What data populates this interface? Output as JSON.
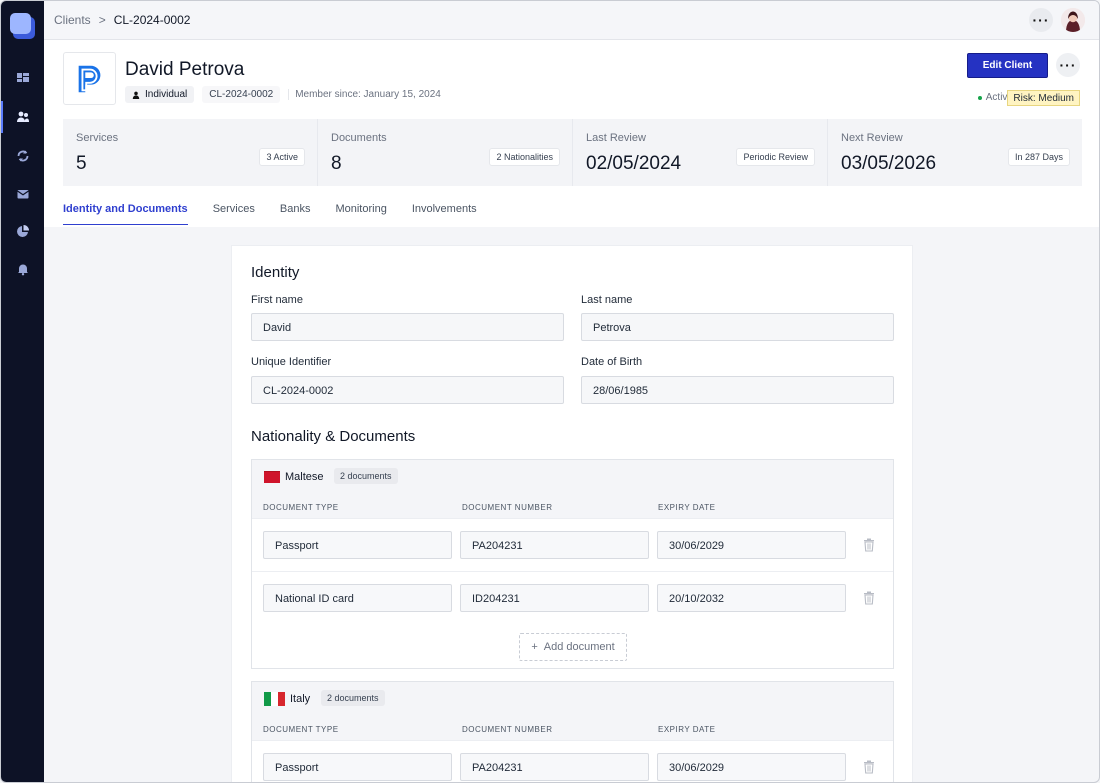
{
  "breadcrumb": {
    "parent": "Clients",
    "separator": ">",
    "current": "CL-2024-0002"
  },
  "client": {
    "name": "David Petrova",
    "type": "Individual",
    "id": "CL-2024-0002",
    "member_since": "Member since: January 15,  2024",
    "status": "Active",
    "risk": "Risk: Medium",
    "edit_label": "Edit Client"
  },
  "stats": [
    {
      "label": "Services",
      "value": "5",
      "pill": "3 Active"
    },
    {
      "label": "Documents",
      "value": "8",
      "pill": "2 Nationalities"
    },
    {
      "label": "Last Review",
      "value": "02/05/2024",
      "pill": "Periodic Review"
    },
    {
      "label": "Next Review",
      "value": "03/05/2026",
      "pill": "In 287 Days"
    }
  ],
  "tabs": [
    "Identity and Documents",
    "Services",
    "Banks",
    "Monitoring",
    "Involvements"
  ],
  "identity": {
    "title": "Identity",
    "first_name_label": "First name",
    "first_name": "David",
    "last_name_label": "Last name",
    "last_name": "Petrova",
    "uid_label": "Unique Identifier",
    "uid": "CL-2024-0002",
    "dob_label": "Date of Birth",
    "dob": "28/06/1985"
  },
  "nationality": {
    "title": "Nationality & Documents",
    "col_type": "DOCUMENT TYPE",
    "col_number": "DOCUMENT NUMBER",
    "col_expiry": "EXPIRY DATE",
    "add_label": "Add document",
    "groups": [
      {
        "name": "Maltese",
        "count": "2 documents",
        "docs": [
          {
            "type": "Passport",
            "number": "PA204231",
            "expiry": "30/06/2029"
          },
          {
            "type": "National ID card",
            "number": "ID204231",
            "expiry": "20/10/2032"
          }
        ]
      },
      {
        "name": "Italy",
        "count": "2 documents",
        "docs": [
          {
            "type": "Passport",
            "number": "PA204231",
            "expiry": "30/06/2029"
          }
        ]
      }
    ]
  },
  "colors": {
    "sidebar": "#0d1226",
    "accent": "#2532c2",
    "tab_active": "#2f3fcf",
    "risk_bg": "#fff4c2"
  },
  "icons": [
    "dashboard-icon",
    "clients-icon",
    "sync-icon",
    "inbox-icon",
    "chart-icon",
    "bell-icon",
    "user-icon",
    "trash-icon",
    "plus-icon"
  ]
}
